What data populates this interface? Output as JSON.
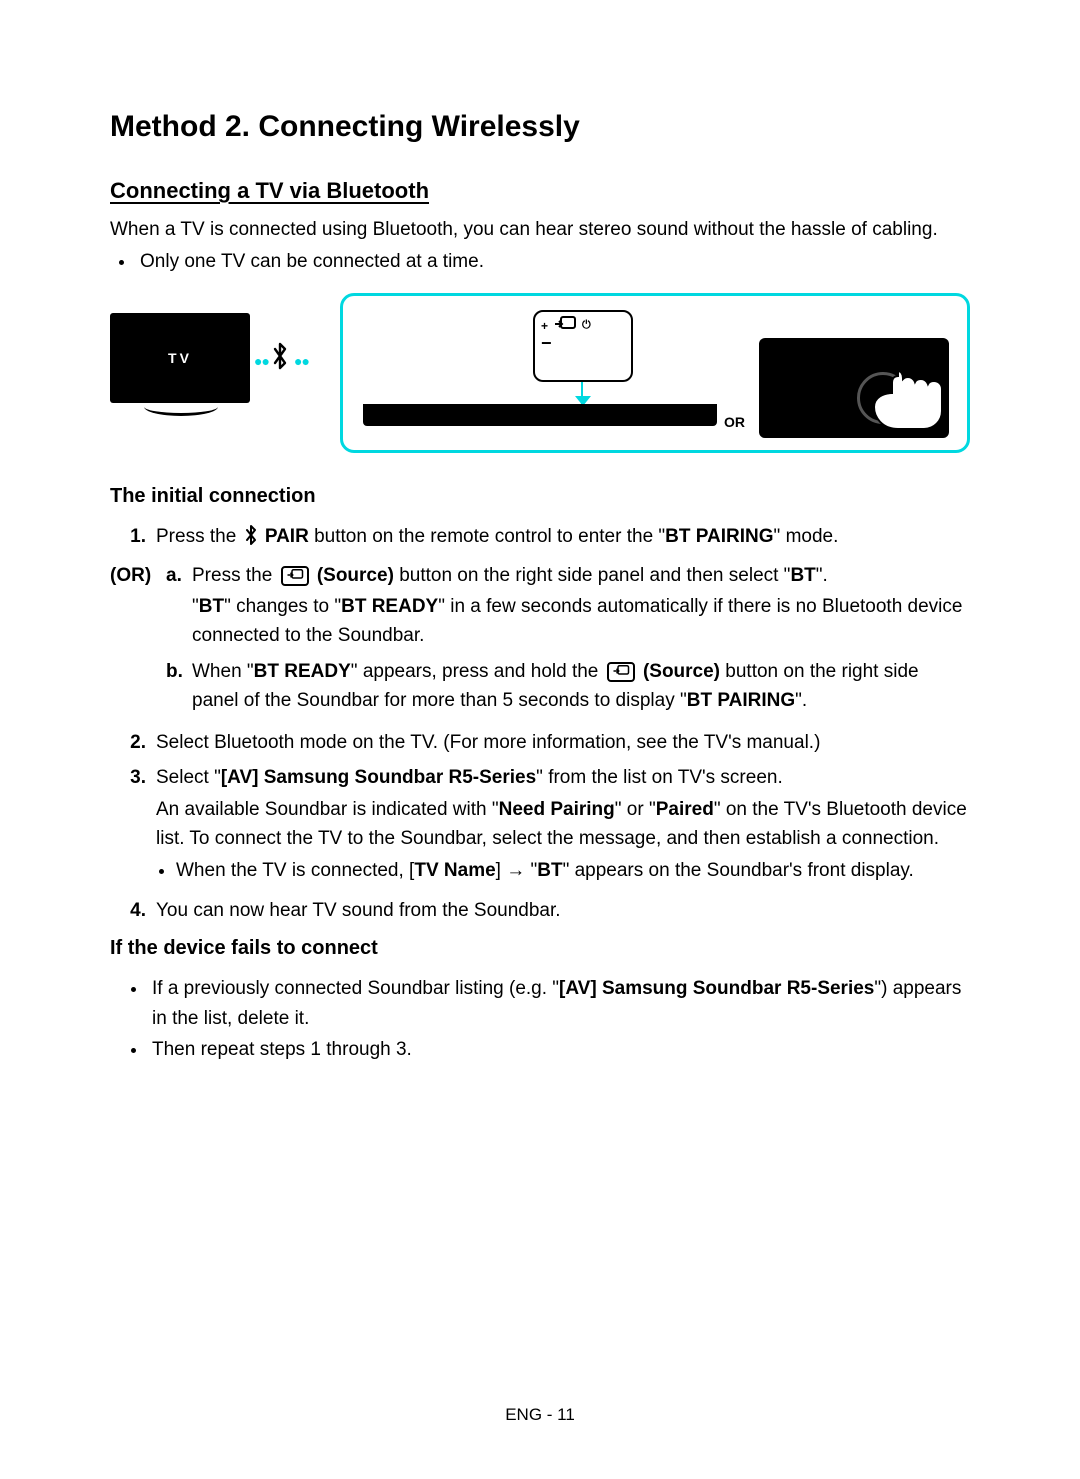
{
  "title": "Method 2. Connecting Wirelessly",
  "subtitle": "Connecting a TV via Bluetooth",
  "intro": "When a TV is connected using Bluetooth, you can hear stereo sound without the hassle of cabling.",
  "note1": "Only one TV can be connected at a time.",
  "illus": {
    "tv_label": "TV",
    "or_label": "OR",
    "btn_plus": "+",
    "btn_minus": "−"
  },
  "sec_initial": "The initial connection",
  "step1_pre": "Press the ",
  "step1_pair": "PAIR",
  "step1_mid": " button on the remote control to enter the \"",
  "step1_bt_pairing": "BT PAIRING",
  "step1_post": "\" mode.",
  "or_label": "(OR)",
  "step_a_pre": "Press the ",
  "step_a_source": "(Source)",
  "step_a_mid": " button on the right side panel and then select \"",
  "step_a_bt": "BT",
  "step_a_post": "\".",
  "step_a2_pre": "\"",
  "step_a2_bt": "BT",
  "step_a2_mid": "\" changes to \"",
  "step_a2_bt_ready": "BT READY",
  "step_a2_post": "\" in a few seconds automatically if there is no Bluetooth device connected to the Soundbar.",
  "step_b_pre": "When \"",
  "step_b_bt_ready": "BT READY",
  "step_b_mid": "\" appears, press and hold the ",
  "step_b_source": "(Source)",
  "step_b_mid2": " button on the right side panel of the Soundbar for more than 5 seconds to display \"",
  "step_b_bt_pairing": "BT PAIRING",
  "step_b_post": "\".",
  "step2": "Select Bluetooth mode on the TV. (For more information, see the TV's manual.)",
  "step3_pre": "Select \"",
  "step3_model": "[AV] Samsung Soundbar R5-Series",
  "step3_mid": "\" from the list on TV's screen.",
  "step3_line2a": "An available Soundbar is indicated with \"",
  "step3_need_pairing": "Need Pairing",
  "step3_line2b": "\" or \"",
  "step3_paired": "Paired",
  "step3_line2c": "\" on the TV's Bluetooth device list. To connect the TV to the Soundbar, select the message, and then establish a connection.",
  "step3_sub_pre": "When the TV is connected, [",
  "step3_tv_name": "TV Name",
  "step3_sub_mid": "] → \"",
  "step3_sub_bt": "BT",
  "step3_sub_post": "\" appears on the Soundbar's front display.",
  "step4": "You can now hear TV sound from the Soundbar.",
  "sec_fail": "If the device fails to connect",
  "fail1_pre": "If a previously connected Soundbar listing (e.g. \"",
  "fail1_model": "[AV] Samsung Soundbar R5-Series",
  "fail1_post": "\") appears in the list, delete it.",
  "fail2": "Then repeat steps 1 through 3.",
  "footer": "ENG - 11",
  "nums": {
    "n1": "1.",
    "n2": "2.",
    "n3": "3.",
    "n4": "4.",
    "a": "a.",
    "b": "b."
  }
}
